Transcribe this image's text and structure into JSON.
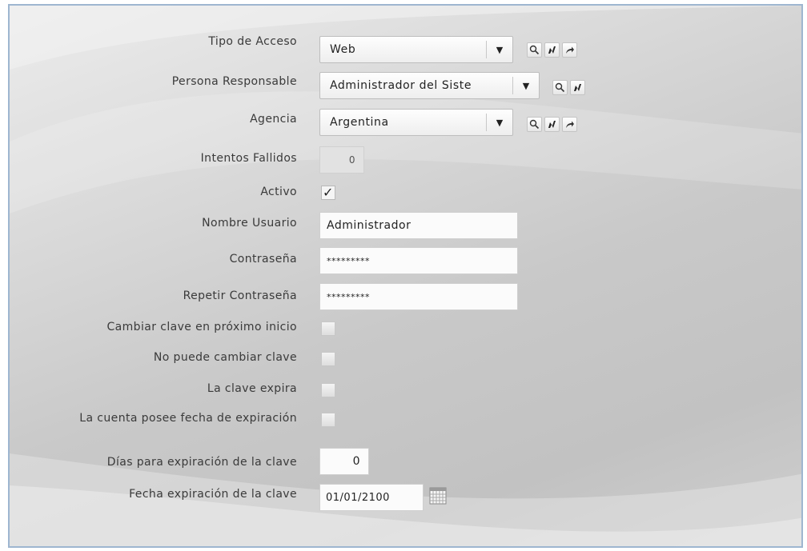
{
  "form": {
    "tipo_acceso": {
      "label": "Tipo de Acceso",
      "value": "Web",
      "icons": [
        "search-icon",
        "edit-icon",
        "go-icon"
      ]
    },
    "persona_responsable": {
      "label": "Persona Responsable",
      "value": "Administrador del Siste",
      "icons": [
        "search-icon",
        "edit-icon"
      ]
    },
    "agencia": {
      "label": "Agencia",
      "value": "Argentina",
      "icons": [
        "search-icon",
        "edit-icon",
        "go-icon"
      ]
    },
    "intentos_fallidos": {
      "label": "Intentos Fallidos",
      "value": "0"
    },
    "activo": {
      "label": "Activo",
      "checked": true,
      "check_glyph": "✓"
    },
    "nombre_usuario": {
      "label": "Nombre Usuario",
      "value": "Administrador"
    },
    "contrasena": {
      "label": "Contraseña",
      "value": "*********"
    },
    "repetir_contrasena": {
      "label": "Repetir Contraseña",
      "value": "*********"
    },
    "cambiar_clave": {
      "label": "Cambiar clave en próximo inicio",
      "checked": false
    },
    "no_puede_cambiar": {
      "label": "No puede cambiar clave",
      "checked": false
    },
    "clave_expira": {
      "label": "La clave expira",
      "checked": false
    },
    "cuenta_expira": {
      "label": "La cuenta posee fecha de expiración",
      "checked": false
    },
    "dias_expiracion": {
      "label": "Días para expiración de la clave",
      "value": "0"
    },
    "fecha_expiracion": {
      "label": "Fecha expiración de la clave",
      "value": "01/01/2100",
      "icon": "calendar-icon"
    }
  },
  "dropdown_arrow": "▼",
  "colors": {
    "panel_border": "#9eb6d0",
    "panel_bg": "#d4d4d4",
    "field_bg": "#fbfbfb"
  }
}
